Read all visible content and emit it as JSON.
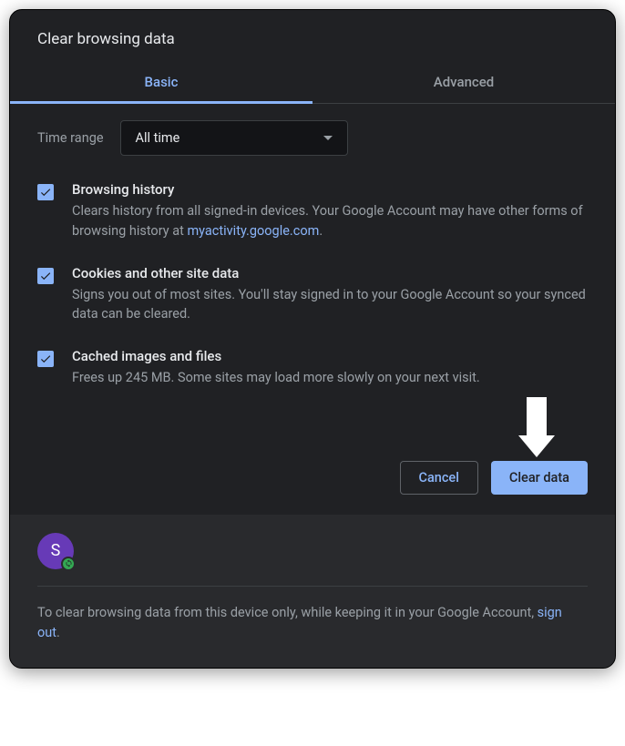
{
  "dialog": {
    "title": "Clear browsing data"
  },
  "tabs": {
    "basic": "Basic",
    "advanced": "Advanced"
  },
  "time_range": {
    "label": "Time range",
    "value": "All time"
  },
  "options": {
    "browsing_history": {
      "title": "Browsing history",
      "desc_prefix": "Clears history from all signed-in devices. Your Google Account may have other forms of browsing history at ",
      "link": "myactivity.google.com",
      "desc_suffix": "."
    },
    "cookies": {
      "title": "Cookies and other site data",
      "desc": "Signs you out of most sites. You'll stay signed in to your Google Account so your synced data can be cleared."
    },
    "cache": {
      "title": "Cached images and files",
      "desc": "Frees up 245 MB. Some sites may load more slowly on your next visit."
    }
  },
  "buttons": {
    "cancel": "Cancel",
    "clear": "Clear data"
  },
  "footer": {
    "avatar_letter": "S",
    "text_prefix": "To clear browsing data from this device only, while keeping it in your Google Account, ",
    "link": "sign out",
    "text_suffix": "."
  }
}
